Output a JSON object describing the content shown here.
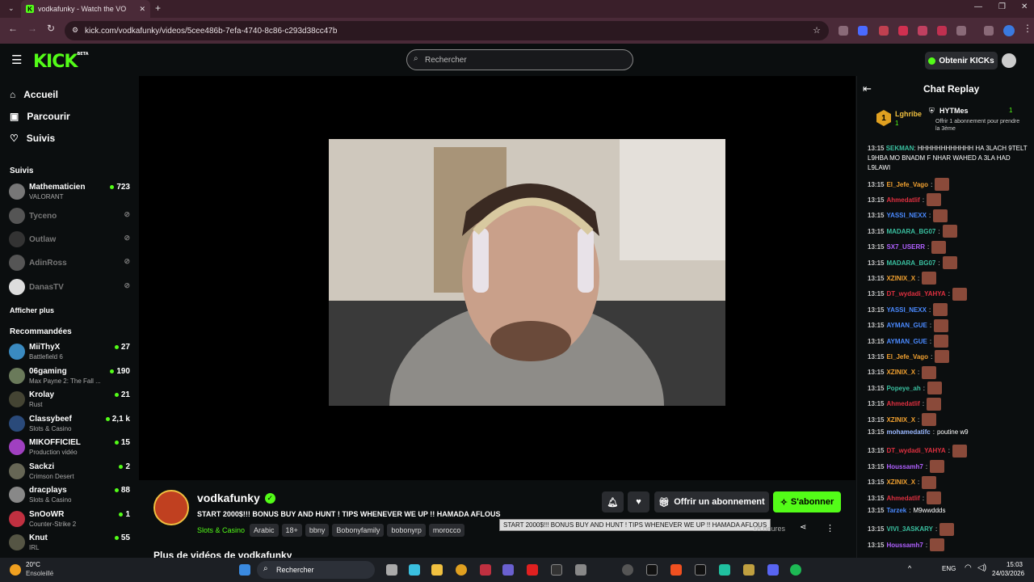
{
  "browser": {
    "tab_title": "vodkafunky - Watch the VO",
    "url": "kick.com/vodkafunky/videos/5cee486b-7efa-4740-8c86-c293d38cc47b"
  },
  "header": {
    "logo": "KICK",
    "logo_badge": "BETA",
    "search_placeholder": "Rechercher",
    "obtenir_label": "Obtenir KICKs"
  },
  "sidebar": {
    "nav": [
      {
        "label": "Accueil",
        "icon": "home-icon"
      },
      {
        "label": "Parcourir",
        "icon": "browse-icon"
      },
      {
        "label": "Suivis",
        "icon": "heart-icon"
      }
    ],
    "suivis_title": "Suivis",
    "followed": [
      {
        "name": "Mathematicien",
        "sub": "VALORANT",
        "viewers": "723",
        "live": true
      },
      {
        "name": "Tyceno",
        "live": false
      },
      {
        "name": "Outlaw",
        "live": false
      },
      {
        "name": "AdinRoss",
        "live": false
      },
      {
        "name": "DanasTV",
        "live": false
      }
    ],
    "show_more": "Afficher plus",
    "recommended_title": "Recommandées",
    "recommended": [
      {
        "name": "MiiThyX",
        "sub": "Battlefield 6",
        "viewers": "27"
      },
      {
        "name": "06gaming",
        "sub": "Max Payne 2: The Fall ...",
        "viewers": "190"
      },
      {
        "name": "Krolay",
        "sub": "Rust",
        "viewers": "21"
      },
      {
        "name": "Classybeef",
        "sub": "Slots & Casino",
        "viewers": "2,1 k"
      },
      {
        "name": "MIKOFFICIEL",
        "sub": "Production vidéo",
        "viewers": "15"
      },
      {
        "name": "Sackzi",
        "sub": "Crimson Desert",
        "viewers": "2"
      },
      {
        "name": "dracplays",
        "sub": "Slots & Casino",
        "viewers": "88"
      },
      {
        "name": "SnOoWR",
        "sub": "Counter-Strike 2",
        "viewers": "1"
      },
      {
        "name": "Knut",
        "sub": "IRL",
        "viewers": "55"
      }
    ]
  },
  "stream": {
    "channel": "vodkafunky",
    "title": "START 2000$!!! BONUS BUY AND HUNT ! TIPS WHENEVER WE UP !! HAMADA AFLOUS",
    "tooltip": "START 2000$!!! BONUS BUY AND HUNT ! TIPS WHENEVER WE UP !! HAMADA AFLOUS",
    "category": "Slots & Casino",
    "tags": [
      "Arabic",
      "18+",
      "bbny",
      "Bobonyfamily",
      "bobonyrp",
      "morocco"
    ],
    "age": "18 heures",
    "gift_label": "Offrir un abonnement",
    "subscribe_label": "S'abonner",
    "more_videos": "Plus de vidéos de vodkafunky"
  },
  "chat": {
    "title": "Chat Replay",
    "top_rank": "1",
    "top_user": "Lghribe",
    "top_count": "1",
    "gifter_user": "HYTMes",
    "gifter_count": "1",
    "gifter_note": "Offrir 1 abonnement pour prendre la 3ème",
    "first_msg_user": "SEKMAN",
    "first_msg_text": "HHHHHHHHHHHH HA 3LACH 9TELT L9HBA MO BNADM F NHAR WAHED A 3LA HAD L9LAWI",
    "messages": [
      {
        "time": "13:15",
        "user": "El_Jefe_Vago",
        "color": "#f0a030",
        "text": ""
      },
      {
        "time": "13:15",
        "user": "Ahmedatlif",
        "color": "#e03040",
        "text": ""
      },
      {
        "time": "13:15",
        "user": "YASSI_NEXX",
        "color": "#4a8aff",
        "text": ""
      },
      {
        "time": "13:15",
        "user": "MADARA_BG07",
        "color": "#3ac0a0",
        "text": ""
      },
      {
        "time": "13:15",
        "user": "SX7_USERR",
        "color": "#b060ff",
        "text": ""
      },
      {
        "time": "13:15",
        "user": "MADARA_BG07",
        "color": "#3ac0a0",
        "text": ""
      },
      {
        "time": "13:15",
        "user": "XZINIX_X",
        "color": "#f0a030",
        "text": ""
      },
      {
        "time": "13:15",
        "user": "DT_wydadi_YAHYA",
        "color": "#e03040",
        "text": ""
      },
      {
        "time": "13:15",
        "user": "YASSI_NEXX",
        "color": "#4a8aff",
        "text": ""
      },
      {
        "time": "13:15",
        "user": "AYMAN_GUE",
        "color": "#4a8aff",
        "text": ""
      },
      {
        "time": "13:15",
        "user": "AYMAN_GUE",
        "color": "#4a8aff",
        "text": ""
      },
      {
        "time": "13:15",
        "user": "El_Jefe_Vago",
        "color": "#f0a030",
        "text": ""
      },
      {
        "time": "13:15",
        "user": "XZINIX_X",
        "color": "#f0a030",
        "text": ""
      },
      {
        "time": "13:15",
        "user": "Popeye_ah",
        "color": "#3ac0a0",
        "text": ""
      },
      {
        "time": "13:15",
        "user": "Ahmedatlif",
        "color": "#e03040",
        "text": ""
      },
      {
        "time": "13:15",
        "user": "XZINIX_X",
        "color": "#f0a030",
        "text": ""
      },
      {
        "time": "13:15",
        "user": "mohamedatifc",
        "color": "#9ab8ff",
        "text": "poutine w9"
      },
      {
        "time": "13:15",
        "user": "DT_wydadi_YAHYA",
        "color": "#e03040",
        "text": ""
      },
      {
        "time": "13:15",
        "user": "Houssamh7",
        "color": "#b060ff",
        "text": ""
      },
      {
        "time": "13:15",
        "user": "XZINIX_X",
        "color": "#f0a030",
        "text": ""
      },
      {
        "time": "13:15",
        "user": "Ahmedatlif",
        "color": "#e03040",
        "text": ""
      },
      {
        "time": "13:15",
        "user": "Tarzek",
        "color": "#4a8aff",
        "text": "M9wwddds"
      },
      {
        "time": "13:15",
        "user": "VIVI_3ASKARY",
        "color": "#3ac0a0",
        "text": ""
      },
      {
        "time": "13:15",
        "user": "Houssamh7",
        "color": "#b060ff",
        "text": ""
      }
    ]
  },
  "taskbar": {
    "weather_temp": "20°C",
    "weather_desc": "Ensoleillé",
    "search_label": "Rechercher",
    "lang": "ENG",
    "time": "15:03",
    "date": "24/03/2026"
  }
}
